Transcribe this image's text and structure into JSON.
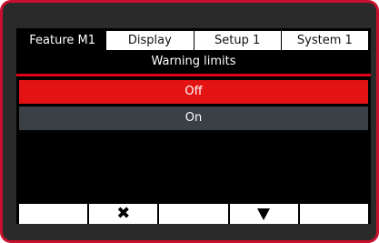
{
  "tabs": [
    {
      "label": "Feature  M1",
      "active": true
    },
    {
      "label": "Display",
      "active": false
    },
    {
      "label": "Setup 1",
      "active": false
    },
    {
      "label": "System 1",
      "active": false
    }
  ],
  "screen": {
    "title": "Warning limits",
    "options": [
      {
        "label": "Off",
        "selected": true
      },
      {
        "label": "On",
        "selected": false
      }
    ]
  },
  "softkeys": [
    {
      "icon": ""
    },
    {
      "icon": "close-icon",
      "glyph": "✖"
    },
    {
      "icon": ""
    },
    {
      "icon": "arrow-down-icon"
    },
    {
      "icon": ""
    }
  ],
  "colors": {
    "bezel_border": "#c8102e",
    "selected_option": "#e31313",
    "unselected_option": "#3a4045",
    "separator": "#e0001a"
  }
}
